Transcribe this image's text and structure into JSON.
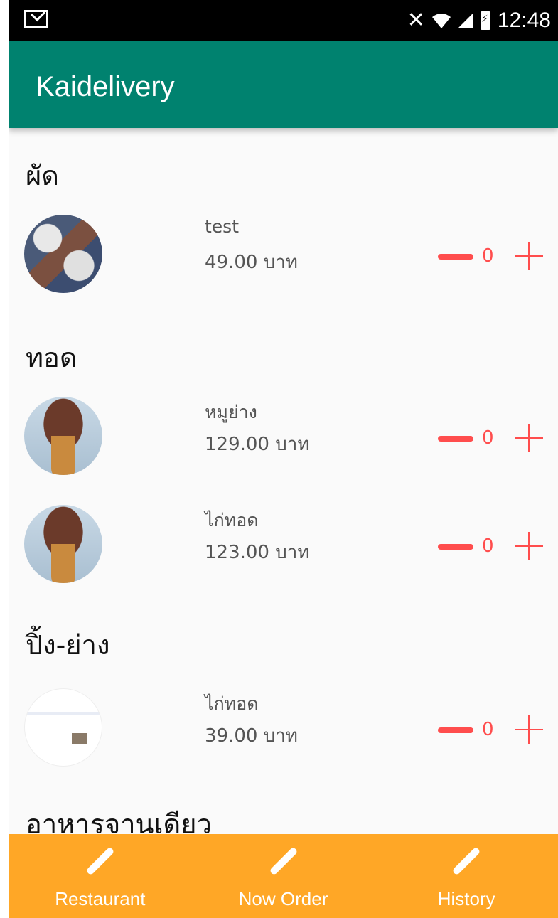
{
  "status_bar": {
    "time": "12:48"
  },
  "app_bar": {
    "title": "Kaidelivery"
  },
  "sections": [
    {
      "title": "ผัด",
      "items": [
        {
          "name": "test",
          "price": "49.00 บาท",
          "qty": "0"
        }
      ]
    },
    {
      "title": "ทอด",
      "items": [
        {
          "name": "หมูย่าง",
          "price": "129.00 บาท",
          "qty": "0"
        },
        {
          "name": "ไก่ทอด",
          "price": "123.00 บาท",
          "qty": "0"
        }
      ]
    },
    {
      "title": "ปิ้ง-ย่าง",
      "items": [
        {
          "name": "ไก่ทอด",
          "price": "39.00 บาท",
          "qty": "0"
        }
      ]
    },
    {
      "title": "อาหารจานเดียว",
      "items": []
    }
  ],
  "bottom_nav": [
    {
      "label": "Restaurant",
      "icon": "pencil-icon"
    },
    {
      "label": "Now Order",
      "icon": "pencil-icon"
    },
    {
      "label": "History",
      "icon": "pencil-icon"
    }
  ],
  "colors": {
    "app_bar": "#00826f",
    "bottom_nav": "#ffa726",
    "accent": "#ff4d4d"
  }
}
